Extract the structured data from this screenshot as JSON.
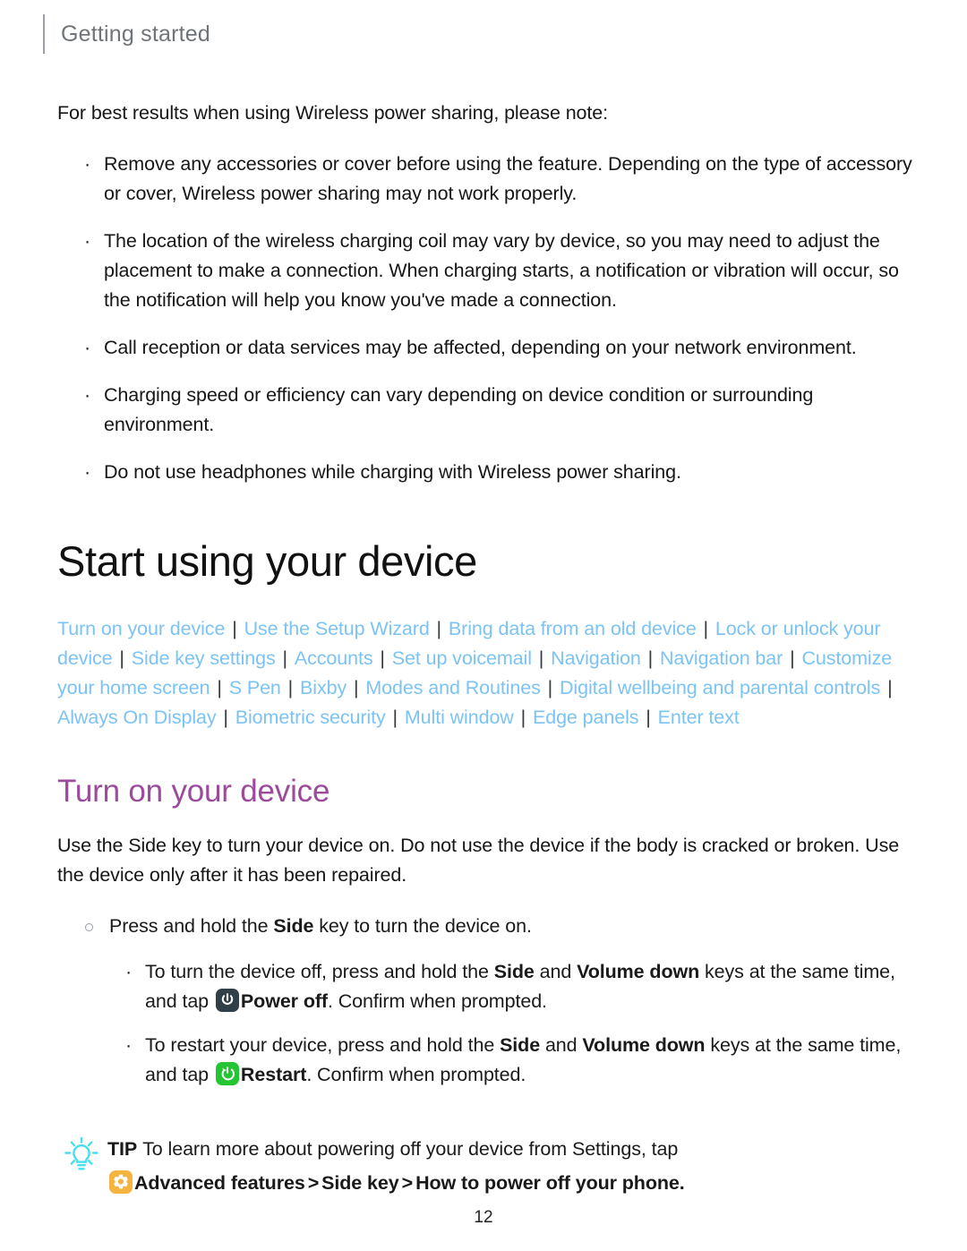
{
  "header": {
    "title": "Getting started"
  },
  "notes": {
    "lead": "For best results when using Wireless power sharing, please note:",
    "bullet_glyph": "·",
    "items": [
      "Remove any accessories or cover before using the feature. Depending on the type of accessory or cover, Wireless power sharing may not work properly.",
      "The location of the wireless charging coil may vary by device, so you may need to adjust the placement to make a connection. When charging starts, a notification or vibration will occur, so the notification will help you know you've made a connection.",
      "Call reception or data services may be affected, depending on your network environment.",
      "Charging speed or efficiency can vary depending on device condition or surrounding environment.",
      "Do not use headphones while charging with Wireless power sharing."
    ]
  },
  "section": {
    "title": "Start using your device",
    "link_color": "#7cc3f5",
    "separator": "|",
    "links": [
      "Turn on your device",
      "Use the Setup Wizard",
      "Bring data from an old device",
      "Lock or unlock your device",
      "Side key settings",
      "Accounts",
      "Set up voicemail",
      "Navigation",
      "Navigation bar",
      "Customize your home screen",
      "S Pen",
      "Bixby",
      "Modes and Routines",
      "Digital wellbeing and parental controls",
      "Always On Display",
      "Biometric security",
      "Multi window",
      "Edge panels",
      "Enter text"
    ]
  },
  "subsection": {
    "title": "Turn on your device",
    "title_color": "#9c4a9c",
    "intro": "Use the Side key to turn your device on. Do not use the device if the body is cracked or broken. Use the device only after it has been repaired.",
    "step": {
      "before": "Press and hold the ",
      "bold": "Side",
      "after": " key to turn the device on."
    },
    "substeps": [
      {
        "icon": "power-off-icon",
        "icon_color": "#313f48",
        "part1": "To turn the device off, press and hold the ",
        "bold1": "Side",
        "part2": " and ",
        "bold2": "Volume down",
        "part3": " keys at the same time, and tap ",
        "bold3": "Power off",
        "part4": ". Confirm when prompted."
      },
      {
        "icon": "restart-icon",
        "icon_color": "#24c433",
        "part1": "To restart your device, press and hold the ",
        "bold1": "Side",
        "part2": " and ",
        "bold2": "Volume down",
        "part3": " keys at the same time, and tap ",
        "bold3": "Restart",
        "part4": ". Confirm when prompted."
      }
    ]
  },
  "tip": {
    "label": "TIP",
    "text": "To learn more about powering off your device from Settings, tap",
    "icon": "settings-gear-icon",
    "icon_color": "#f5b340",
    "bulb_color": "#45dff0",
    "path1": "Advanced features",
    "chevron": ">",
    "path2": "Side key",
    "path3": "How to power off your phone."
  },
  "footer": {
    "page_number": "12"
  }
}
